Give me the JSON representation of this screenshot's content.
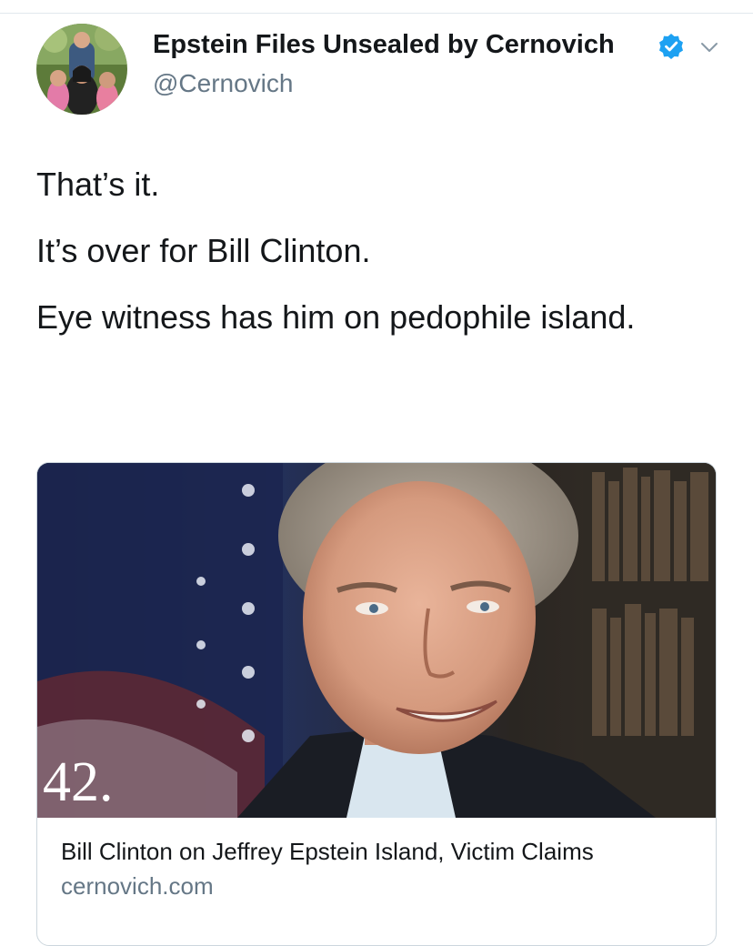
{
  "tweet": {
    "display_name": "Epstein Files Unsealed by Cernovich",
    "handle": "@Cernovich",
    "verified_icon": "verified-badge-icon",
    "menu_icon": "chevron-down-icon",
    "lines": [
      "That’s it.",
      "It’s over for Bill Clinton.",
      "Eye witness has him on pedophile island."
    ]
  },
  "card": {
    "image_overlay_number": "42.",
    "title": "Bill Clinton on Jeffrey Epstein Island, Victim Claims",
    "domain": "cernovich.com"
  },
  "colors": {
    "verified_blue": "#1da1f2",
    "secondary_text": "#657786",
    "primary_text": "#14171a",
    "border": "#ccd6dd"
  }
}
